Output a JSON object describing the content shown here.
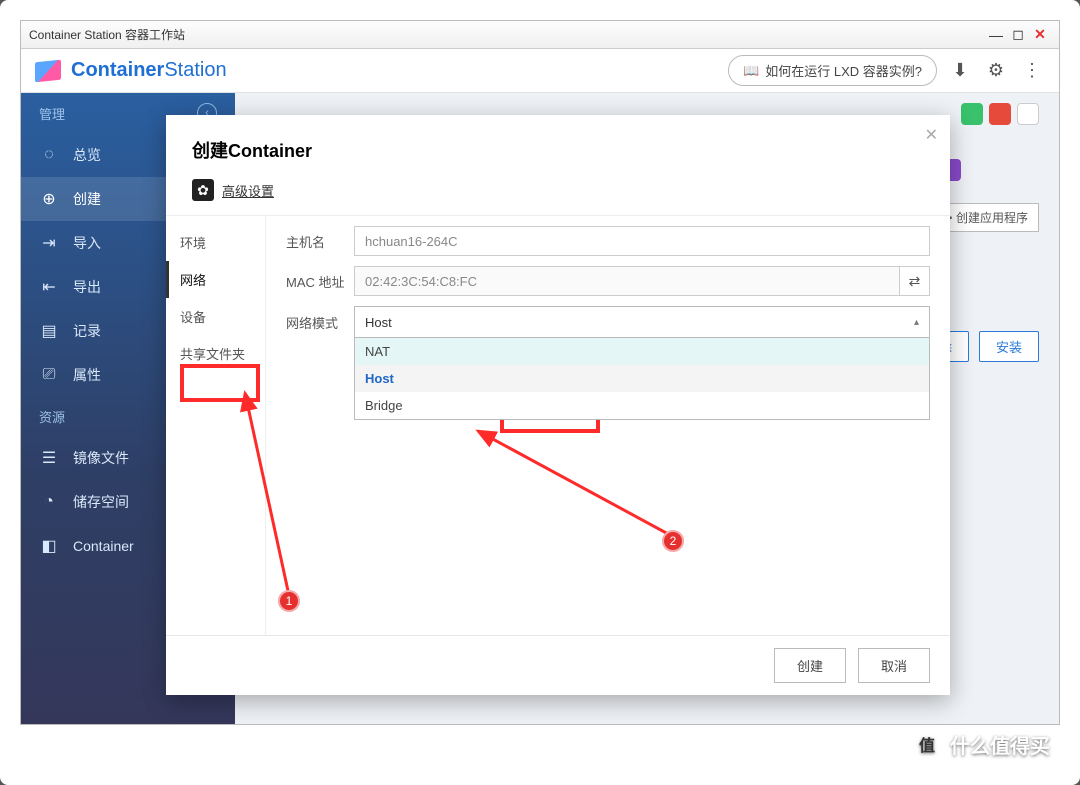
{
  "window": {
    "title": "Container Station 容器工作站"
  },
  "brand": {
    "bold": "Container",
    "light": "Station"
  },
  "header": {
    "help_pill": "如何在运行 LXD 容器实例?",
    "icons": [
      "download-icon",
      "gear-icon",
      "more-icon"
    ]
  },
  "sidebar": {
    "section1": "管理",
    "section2": "资源",
    "items1": [
      {
        "label": "总览",
        "icon": "dashboard-icon"
      },
      {
        "label": "创建",
        "icon": "plus-circle-icon",
        "active": true
      },
      {
        "label": "导入",
        "icon": "import-icon"
      },
      {
        "label": "导出",
        "icon": "export-icon"
      },
      {
        "label": "记录",
        "icon": "log-icon"
      },
      {
        "label": "属性",
        "icon": "sliders-icon"
      }
    ],
    "items2": [
      {
        "label": "镜像文件",
        "icon": "layers-icon"
      },
      {
        "label": "储存空间",
        "icon": "database-icon"
      },
      {
        "label": "Container",
        "icon": "cube-icon"
      }
    ]
  },
  "background": {
    "create_app_btn": "创建应用程序",
    "delete_btn": "删除",
    "install_btn": "安装"
  },
  "modal": {
    "title": "创建Container",
    "advanced": "高级设置",
    "tabs": [
      "环境",
      "网络",
      "设备",
      "共享文件夹"
    ],
    "active_tab": "网络",
    "form": {
      "host_label": "主机名",
      "host_value": "hchuan16-264C",
      "mac_label": "MAC 地址",
      "mac_value": "02:42:3C:54:C8:FC",
      "netmode_label": "网络模式",
      "netmode_value": "Host",
      "netmode_options": [
        "NAT",
        "Host",
        "Bridge"
      ]
    },
    "create_btn": "创建",
    "cancel_btn": "取消"
  },
  "annotations": {
    "badge1": "1",
    "badge2": "2"
  },
  "watermark": "什么值得买"
}
